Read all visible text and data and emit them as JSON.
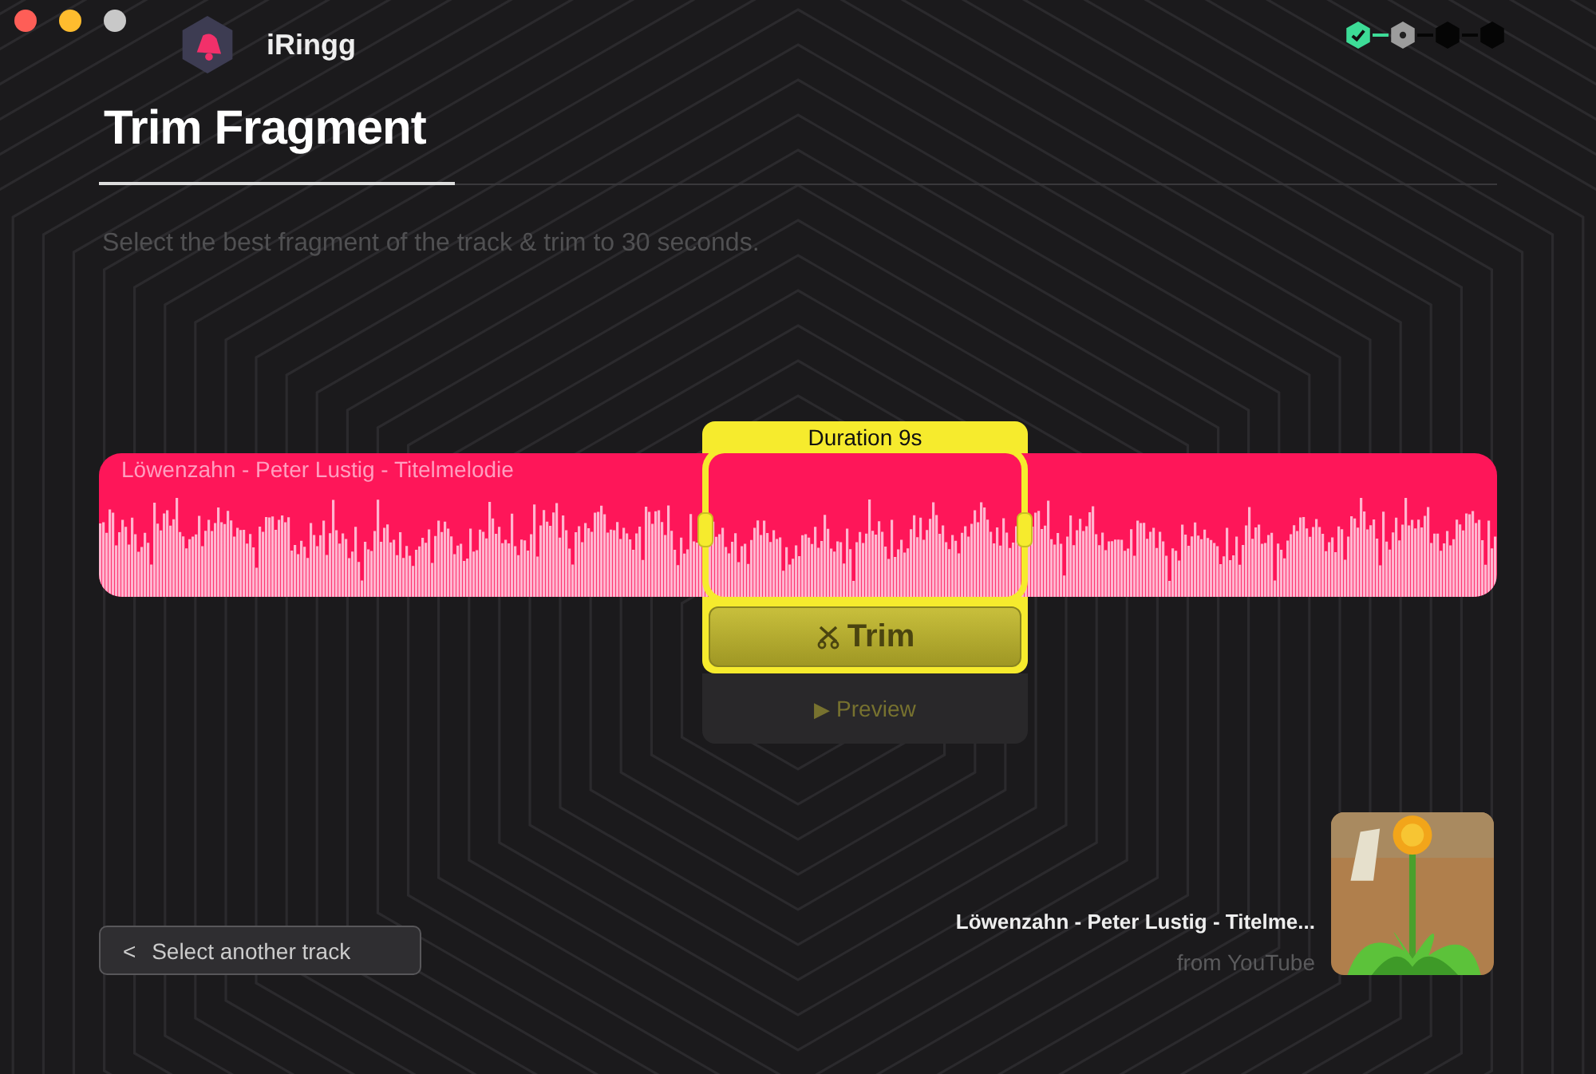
{
  "window": {
    "app_name": "iRingg"
  },
  "steps": [
    {
      "done": true,
      "current": false
    },
    {
      "done": false,
      "current": true
    },
    {
      "done": false,
      "current": false
    },
    {
      "done": false,
      "current": false
    }
  ],
  "page": {
    "title": "Trim Fragment",
    "subtitle": "Select the best fragment of the track & trim to 30 seconds."
  },
  "track": {
    "title": "Löwenzahn - Peter Lustig - Titelmelodie"
  },
  "selection": {
    "duration": "Duration 9s",
    "trim_button": "Trim",
    "preview_button": "Preview",
    "preview_icon": "▶"
  },
  "back_button": {
    "icon": "<",
    "label": "Select another track"
  },
  "source": {
    "title": "Löwenzahn - Peter Lustig - Titelme...",
    "origin": "from YouTube"
  }
}
